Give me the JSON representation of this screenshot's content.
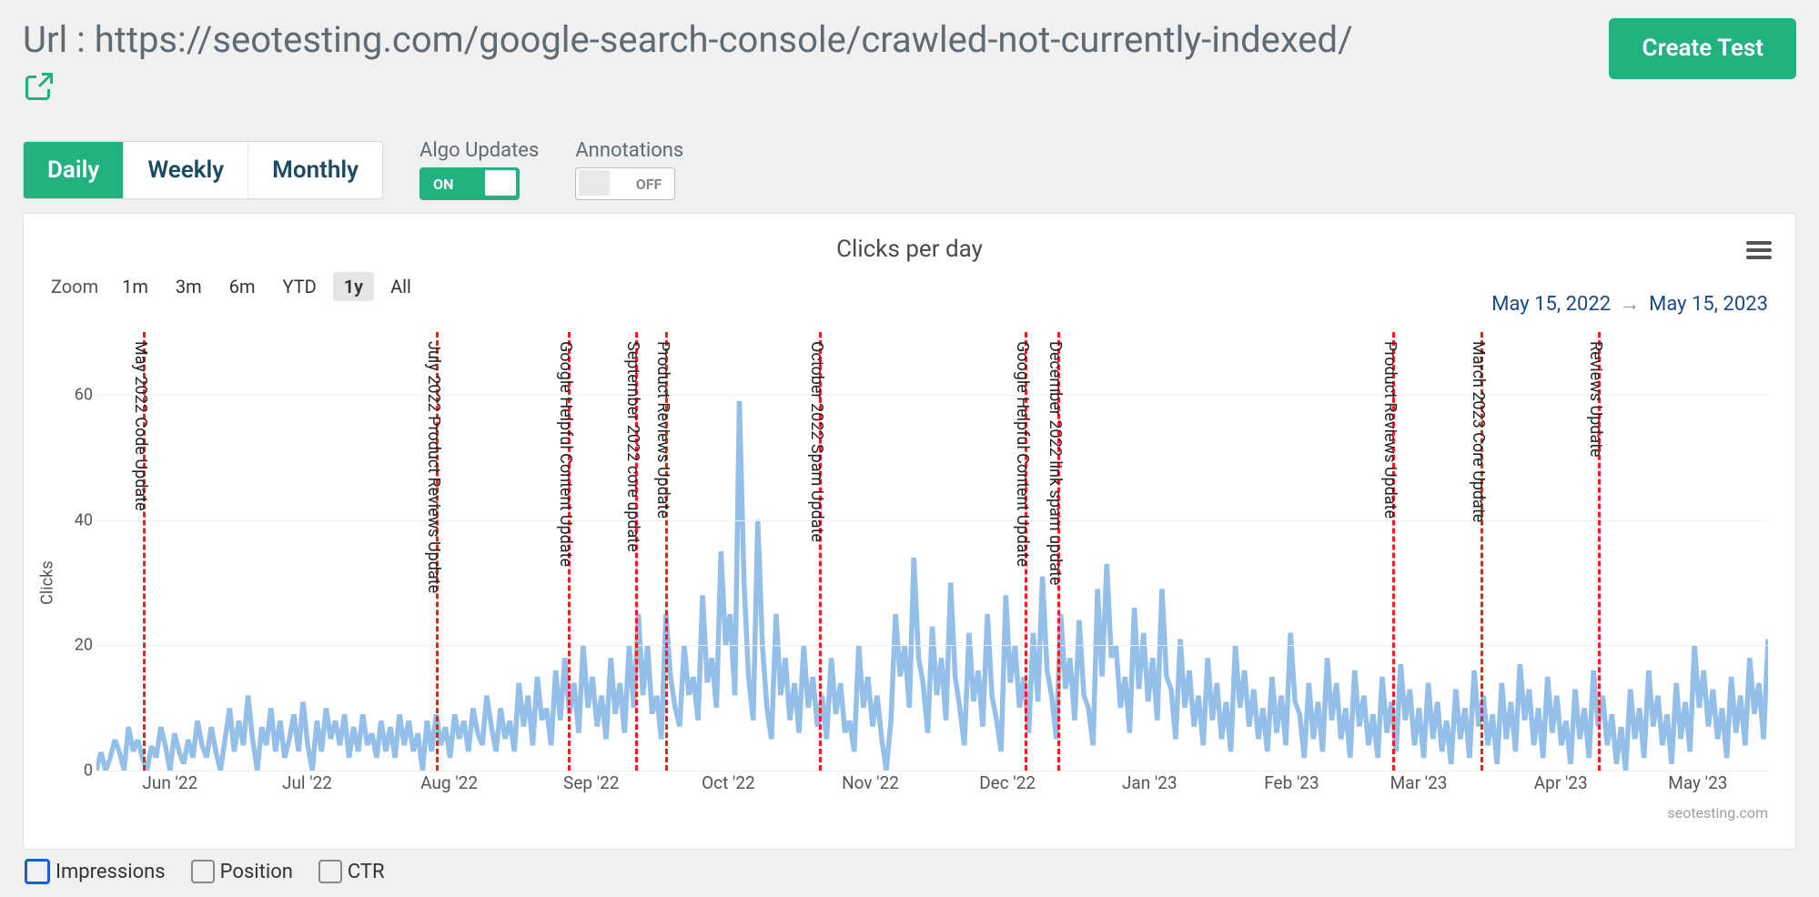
{
  "header": {
    "url_label": "Url : https://seotesting.com/google-search-console/crawled-not-currently-indexed/",
    "create_button": "Create\nTest"
  },
  "tabs": {
    "items": [
      "Daily",
      "Weekly",
      "Monthly"
    ],
    "active": 0
  },
  "toggles": {
    "algo": {
      "label": "Algo Updates",
      "state": "ON"
    },
    "annotations": {
      "label": "Annotations",
      "state": "OFF"
    }
  },
  "chart_data": {
    "type": "line",
    "title": "Clicks per day",
    "ylabel": "Clicks",
    "ylim": [
      0,
      70
    ],
    "yticks": [
      0,
      20,
      40,
      60
    ],
    "x_start": "2022-05-15",
    "x_end": "2023-05-15",
    "x_tick_labels": [
      "Jun '22",
      "Jul '22",
      "Aug '22",
      "Sep '22",
      "Oct '22",
      "Nov '22",
      "Dec '22",
      "Jan '23",
      "Feb '23",
      "Mar '23",
      "Apr '23",
      "May '23"
    ],
    "x_tick_pos": [
      0.044,
      0.126,
      0.211,
      0.296,
      0.378,
      0.463,
      0.545,
      0.63,
      0.715,
      0.791,
      0.876,
      0.958
    ],
    "date_range": {
      "from": "May 15, 2022",
      "to": "May 15, 2023"
    },
    "zoom": {
      "label": "Zoom",
      "options": [
        "1m",
        "3m",
        "6m",
        "YTD",
        "1y",
        "All"
      ],
      "active": "1y"
    },
    "credits": "seotesting.com",
    "values": [
      0,
      3,
      0,
      2,
      5,
      3,
      0,
      7,
      3,
      5,
      2,
      0,
      4,
      2,
      7,
      4,
      0,
      6,
      3,
      1,
      5,
      2,
      8,
      4,
      2,
      7,
      3,
      0,
      5,
      10,
      3,
      8,
      4,
      12,
      5,
      0,
      7,
      4,
      10,
      3,
      8,
      2,
      5,
      9,
      3,
      11,
      4,
      0,
      8,
      3,
      10,
      5,
      8,
      4,
      9,
      2,
      7,
      3,
      9,
      4,
      6,
      2,
      8,
      3,
      7,
      2,
      9,
      4,
      8,
      3,
      6,
      0,
      8,
      3,
      9,
      4,
      7,
      2,
      9,
      5,
      8,
      3,
      10,
      6,
      4,
      12,
      7,
      3,
      10,
      5,
      8,
      3,
      14,
      7,
      12,
      4,
      15,
      8,
      10,
      4,
      16,
      8,
      18,
      9,
      14,
      6,
      20,
      10,
      15,
      7,
      12,
      5,
      18,
      9,
      14,
      6,
      20,
      10,
      25,
      12,
      20,
      9,
      12,
      5,
      25,
      15,
      10,
      7,
      20,
      12,
      15,
      8,
      28,
      14,
      18,
      10,
      35,
      20,
      25,
      12,
      59,
      30,
      15,
      8,
      40,
      20,
      10,
      5,
      25,
      12,
      18,
      8,
      14,
      6,
      20,
      10,
      15,
      7,
      12,
      5,
      18,
      9,
      14,
      6,
      8,
      3,
      20,
      10,
      15,
      7,
      12,
      5,
      0,
      8,
      25,
      15,
      20,
      10,
      34,
      18,
      14,
      6,
      23,
      12,
      18,
      8,
      30,
      15,
      10,
      4,
      22,
      11,
      16,
      7,
      25,
      12,
      8,
      3,
      28,
      14,
      20,
      10,
      15,
      6,
      22,
      11,
      31,
      16,
      12,
      5,
      25,
      13,
      18,
      8,
      24,
      12,
      10,
      4,
      29,
      15,
      33,
      18,
      20,
      10,
      15,
      6,
      26,
      13,
      22,
      11,
      18,
      8,
      29,
      15,
      13,
      5,
      21,
      10,
      16,
      7,
      12,
      4,
      18,
      8,
      14,
      5,
      11,
      3,
      20,
      10,
      16,
      7,
      13,
      5,
      10,
      3,
      15,
      6,
      12,
      4,
      22,
      11,
      9,
      2,
      14,
      5,
      11,
      3,
      18,
      8,
      14,
      5,
      10,
      2,
      16,
      7,
      12,
      4,
      9,
      2,
      15,
      6,
      11,
      3,
      17,
      8,
      13,
      4,
      10,
      2,
      14,
      5,
      11,
      3,
      8,
      1,
      13,
      5,
      10,
      2,
      16,
      7,
      12,
      4,
      9,
      1,
      14,
      5,
      11,
      3,
      17,
      8,
      13,
      4,
      10,
      2,
      15,
      6,
      12,
      4,
      8,
      1,
      13,
      5,
      10,
      2,
      16,
      7,
      12,
      4,
      9,
      1,
      7,
      0,
      13,
      5,
      10,
      2,
      16,
      7,
      12,
      4,
      9,
      1,
      14,
      5,
      11,
      3,
      20,
      10,
      16,
      7,
      13,
      5,
      10,
      2,
      15,
      6,
      12,
      4,
      18,
      9,
      14,
      5,
      21
    ],
    "annotations": [
      {
        "label": "May 2022 Code Update",
        "pos": 0.028
      },
      {
        "label": "July 2022 Product Reviews Update",
        "pos": 0.203
      },
      {
        "label": "Google Helpful Content Update",
        "pos": 0.282
      },
      {
        "label": "September 2022 core update",
        "pos": 0.322
      },
      {
        "label": "Product Reviews Update",
        "pos": 0.34
      },
      {
        "label": "October 2022 Spam Update",
        "pos": 0.432
      },
      {
        "label": "Google Helpful Content Update",
        "pos": 0.555
      },
      {
        "label": "December 2022 link spam update",
        "pos": 0.575
      },
      {
        "label": "Product Reviews Update",
        "pos": 0.775
      },
      {
        "label": "March 2023 Core Update",
        "pos": 0.828
      },
      {
        "label": "Reviews Update",
        "pos": 0.898
      }
    ]
  },
  "footer_checks": [
    {
      "label": "Impressions",
      "highlight": true
    },
    {
      "label": "Position",
      "highlight": false
    },
    {
      "label": "CTR",
      "highlight": false
    }
  ]
}
